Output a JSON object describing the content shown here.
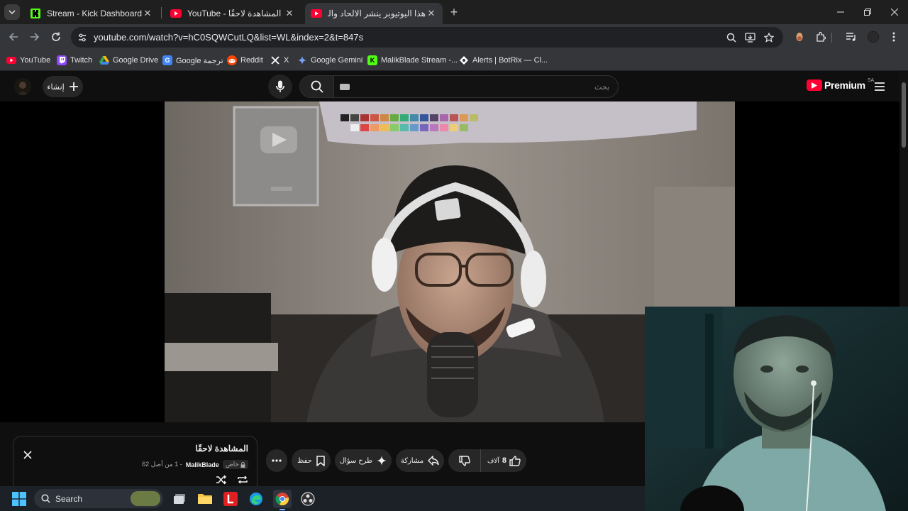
{
  "browser": {
    "tabs": [
      {
        "title": "Stream - Kick Dashboard",
        "favicon": "kick-icon",
        "active": false
      },
      {
        "title": "YouTube - المشاهدة لاحقًا",
        "favicon": "youtube-icon",
        "active": false
      },
      {
        "title": "هذا اليوتيوبر ينشر الالحاد والشذوذ",
        "favicon": "youtube-icon",
        "active": true
      }
    ],
    "url": "youtube.com/watch?v=hC0SQWCutLQ&list=WL&index=2&t=847s",
    "bookmarks": [
      {
        "label": "YouTube",
        "icon": "youtube-icon"
      },
      {
        "label": "Twitch",
        "icon": "twitch-icon"
      },
      {
        "label": "Google Drive",
        "icon": "google-drive-icon"
      },
      {
        "label": "Google ترجمة",
        "icon": "google-translate-icon"
      },
      {
        "label": "Reddit",
        "icon": "reddit-icon"
      },
      {
        "label": "X",
        "icon": "x-icon"
      },
      {
        "label": "Google Gemini",
        "icon": "gemini-icon"
      },
      {
        "label": "MalikBlade Stream -...",
        "icon": "kick-icon"
      },
      {
        "label": "Alerts | BotRix — Cl...",
        "icon": "botrix-icon"
      }
    ]
  },
  "youtube": {
    "create_label": "إنشاء",
    "search_placeholder": "بحث",
    "logo_text": "Premium",
    "country_code": "SA",
    "playlist": {
      "title": "المشاهدة لاحقًا",
      "privacy": "خاص",
      "owner": "MalikBlade",
      "position": "- 1 من أصل 62"
    },
    "actions": {
      "likes": "8",
      "likes_unit": "آلاف",
      "share": "مشاركة",
      "ask": "طرح سؤال",
      "save": "حفظ"
    }
  },
  "taskbar": {
    "search_label": "Search"
  },
  "colors": {
    "brand_youtube": "#ff0033",
    "kick_green": "#53fc18",
    "chrome_dark": "#35363a"
  }
}
